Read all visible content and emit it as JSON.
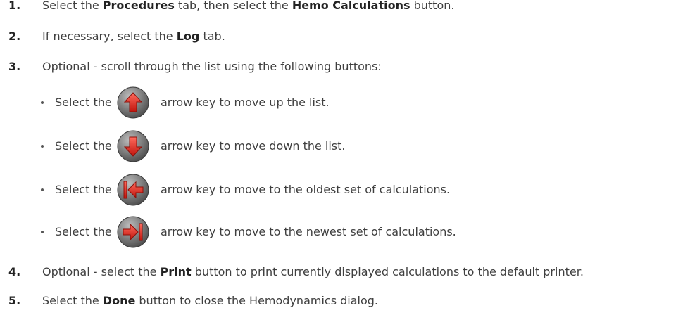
{
  "steps": [
    {
      "num": "1.",
      "parts": [
        {
          "t": "Select the ",
          "b": false
        },
        {
          "t": "Procedures",
          "b": true
        },
        {
          "t": " tab, then select the ",
          "b": false
        },
        {
          "t": "Hemo Calculations",
          "b": true
        },
        {
          "t": " button.",
          "b": false
        }
      ]
    },
    {
      "num": "2.",
      "parts": [
        {
          "t": "If necessary, select the ",
          "b": false
        },
        {
          "t": "Log",
          "b": true
        },
        {
          "t": " tab.",
          "b": false
        }
      ]
    },
    {
      "num": "3.",
      "parts": [
        {
          "t": "Optional - scroll through the list using the following buttons:",
          "b": false
        }
      ]
    },
    {
      "num": "4.",
      "parts": [
        {
          "t": "Optional - select the ",
          "b": false
        },
        {
          "t": "Print",
          "b": true
        },
        {
          "t": " button to print currently displayed calculations to the default printer.",
          "b": false
        }
      ]
    },
    {
      "num": "5.",
      "parts": [
        {
          "t": "Select the ",
          "b": false
        },
        {
          "t": "Done",
          "b": true
        },
        {
          "t": " button to close the Hemodynamics dialog.",
          "b": false
        }
      ]
    }
  ],
  "bullets": [
    {
      "pre": "Select the",
      "icon": "arrow-up-icon",
      "post": "arrow key to move up the list."
    },
    {
      "pre": "Select the",
      "icon": "arrow-down-icon",
      "post": "arrow key to move down the list."
    },
    {
      "pre": "Select the",
      "icon": "arrow-to-oldest-icon",
      "post": "arrow key to move to the oldest set of calculations."
    },
    {
      "pre": "Select the",
      "icon": "arrow-to-newest-icon",
      "post": "arrow key to move to the newest set of calculations."
    }
  ],
  "colors": {
    "button_dark": "#4e4e4e",
    "button_light": "#b8b8b8",
    "arrow_red": "#d9261c",
    "text": "#3f3f3f"
  }
}
